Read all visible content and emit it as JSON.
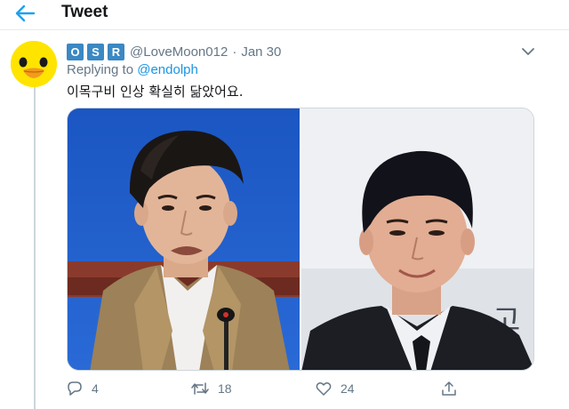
{
  "header": {
    "title": "Tweet",
    "back_icon": "arrow-left-icon",
    "accent_color": "#1da1f2"
  },
  "tweet": {
    "avatar_icon": "yellow-duck-avatar",
    "display_name_badges": [
      "O",
      "S",
      "R"
    ],
    "handle": "@LoveMoon012",
    "separator": "·",
    "timestamp": "Jan 30",
    "menu_icon": "chevron-down-icon",
    "replying_prefix": "Replying to",
    "replying_to": "@endolph",
    "text": "이목구비 인상 확실히 닮았어요.",
    "media": [
      {
        "icon": "photo-left",
        "description_icon": "man-speaking-at-microphone-photo"
      },
      {
        "icon": "photo-right",
        "description_icon": "man-in-suit-photo"
      }
    ],
    "actions": {
      "reply_count": "4",
      "retweet_count": "18",
      "like_count": "24"
    }
  }
}
